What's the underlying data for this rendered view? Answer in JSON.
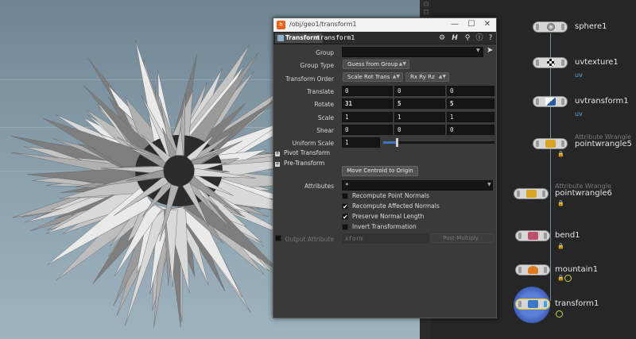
{
  "window": {
    "title": "/obj/geo1/transform1",
    "operator_type": "Transform",
    "node_name": "transform1"
  },
  "params": {
    "group": {
      "label": "Group",
      "value": ""
    },
    "group_type": {
      "label": "Group Type",
      "value": "Guess from Group"
    },
    "transform_order": {
      "label": "Transform Order",
      "order": "Scale Rot Trans",
      "rot_order": "Rx Ry Rz"
    },
    "translate": {
      "label": "Translate",
      "values": [
        "0",
        "0",
        "0"
      ]
    },
    "rotate": {
      "label": "Rotate",
      "values": [
        "31",
        "5",
        "5"
      ]
    },
    "scale": {
      "label": "Scale",
      "values": [
        "1",
        "1",
        "1"
      ]
    },
    "shear": {
      "label": "Shear",
      "values": [
        "0",
        "0",
        "0"
      ]
    },
    "uniform_scale": {
      "label": "Uniform Scale",
      "value": "1",
      "slider_fraction": 0.12
    },
    "pivot_folder": "Pivot Transform",
    "pre_folder": "Pre-Transform",
    "centroid_button": "Move Centroid to Origin",
    "attributes": {
      "label": "Attributes",
      "value": "*"
    },
    "checks": [
      {
        "label": "Recompute Point Normals",
        "checked": false
      },
      {
        "label": "Recompute Affected Normals",
        "checked": true
      },
      {
        "label": "Preserve Normal Length",
        "checked": true
      },
      {
        "label": "Invert Transformation",
        "checked": false
      }
    ],
    "output_attribute": {
      "label": "Output Attribute",
      "value": "xform",
      "mode": "Post-Multiply"
    }
  },
  "network": {
    "nodes": [
      {
        "name": "sphere1",
        "type": "",
        "attr": "",
        "icon_color": "#777777"
      },
      {
        "name": "uvtexture1",
        "type": "",
        "attr": "uv",
        "icon_color": "#222222"
      },
      {
        "name": "uvtransform1",
        "type": "",
        "attr": "uv",
        "icon_color": "#2a5ba0"
      },
      {
        "name": "pointwrangle5",
        "type": "Attribute Wrangle",
        "attr": "",
        "icon_color": "#d9a520"
      },
      {
        "name": "pointwrangle6",
        "type": "Attribute Wrangle",
        "attr": "",
        "icon_color": "#d9a520"
      },
      {
        "name": "bend1",
        "type": "",
        "attr": "",
        "icon_color": "#c0506a"
      },
      {
        "name": "mountain1",
        "type": "",
        "attr": "",
        "icon_color": "#e07a20"
      },
      {
        "name": "transform1",
        "type": "",
        "attr": "",
        "icon_color": "#3a78c4"
      }
    ]
  }
}
